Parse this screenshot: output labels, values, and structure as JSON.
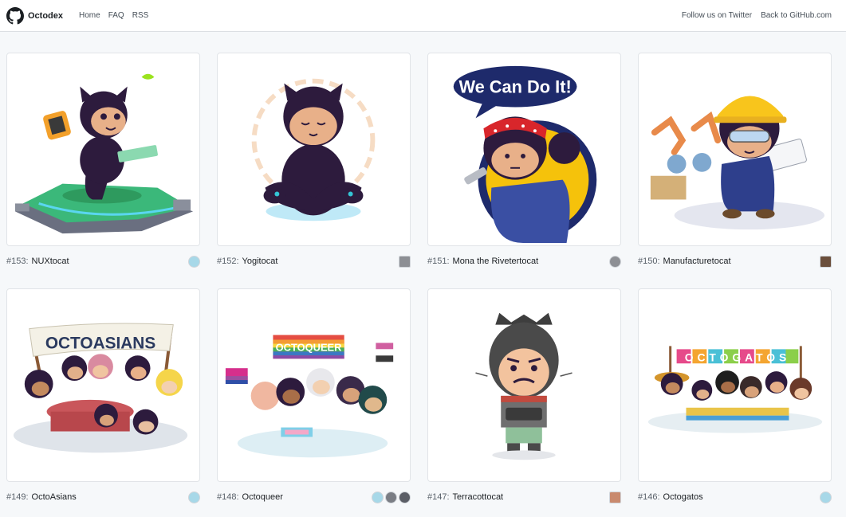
{
  "header": {
    "brand": "Octodex",
    "nav_left": [
      "Home",
      "FAQ",
      "RSS"
    ],
    "nav_right": [
      "Follow us on Twitter",
      "Back to GitHub.com"
    ]
  },
  "cards": [
    {
      "number": "#153:",
      "name": "NUXtocat"
    },
    {
      "number": "#152:",
      "name": "Yogitocat"
    },
    {
      "number": "#151:",
      "name": "Mona the Rivetertocat",
      "banner": "We Can Do It!"
    },
    {
      "number": "#150:",
      "name": "Manufacturetocat"
    },
    {
      "number": "#149:",
      "name": "OctoAsians",
      "banner": "OCTOASIANS"
    },
    {
      "number": "#148:",
      "name": "Octoqueer",
      "banner": "OCTOQUEER"
    },
    {
      "number": "#147:",
      "name": "Terracottocat"
    },
    {
      "number": "#146:",
      "name": "Octogatos",
      "banner": "OCTOGATOS"
    }
  ],
  "colors": {
    "cat_body": "#2d1b3d",
    "cat_face": "#e8b089",
    "riveter_bg": "#f5c20b",
    "riveter_ring": "#1e2a6b",
    "hardhat": "#f8c51c",
    "octoasians_banner": "#f4f1e6",
    "terracotta": "#4a4a4a"
  }
}
